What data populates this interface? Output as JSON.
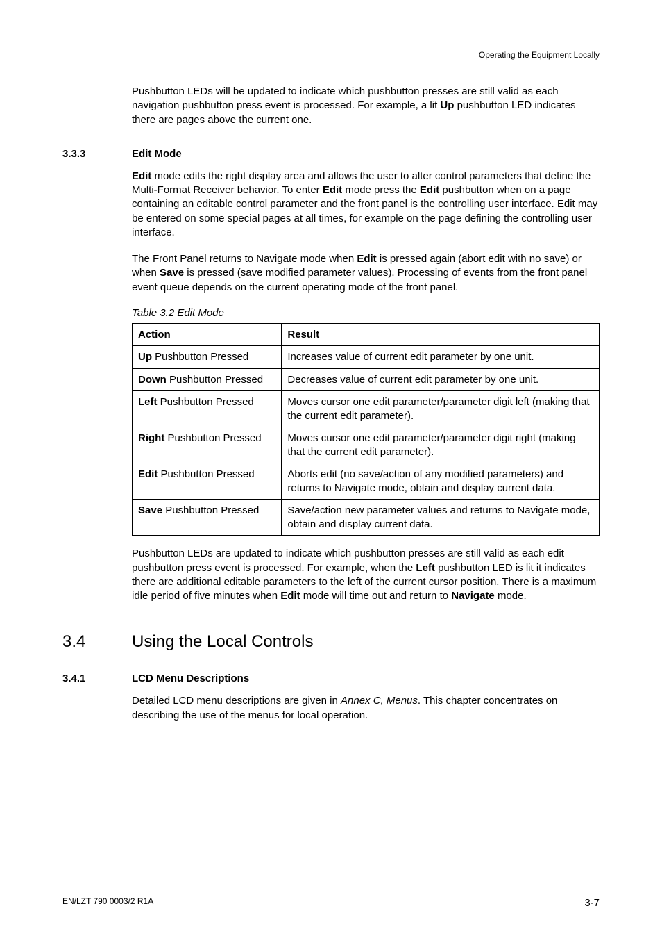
{
  "running_header": "Operating the Equipment Locally",
  "intro_para": "Pushbutton LEDs will be updated to indicate which pushbutton presses are still valid as each navigation pushbutton press event is processed. For example, a lit <b class=\"k\">Up</b> pushbutton LED indicates there are pages above the current one.",
  "s333": {
    "num": "3.3.3",
    "title": "Edit Mode",
    "p1": "<b class=\"k\">Edit</b> mode edits the right display area and allows the user to alter control parameters that define the Multi-Format Receiver behavior. To enter <b class=\"k\">Edit</b> mode press the <b class=\"k\">Edit</b> pushbutton when on a page containing an editable control parameter and the front panel is the controlling user interface. Edit may be entered on some special pages at all times, for example on the page defining the controlling user interface.",
    "p2": "The Front Panel returns to Navigate mode when <b class=\"k\">Edit</b> is pressed again (abort edit with no save) or when <b class=\"k\">Save</b> is pressed (save modified parameter values). Processing of events from the front panel event queue depends on the current operating mode of the front panel."
  },
  "table_caption": "Table 3.2   Edit Mode",
  "table": {
    "headers": {
      "action": "Action",
      "result": "Result"
    },
    "rows": [
      {
        "action": "<b class=\"k\">Up</b> Pushbutton Pressed",
        "result": "Increases value of current edit parameter by one unit."
      },
      {
        "action": "<b class=\"k\">Down</b> Pushbutton Pressed",
        "result": "Decreases value of current edit parameter by one unit."
      },
      {
        "action": "<b class=\"k\">Left</b> Pushbutton Pressed",
        "result": "Moves cursor one edit parameter/parameter digit left (making that the current edit parameter)."
      },
      {
        "action": "<b class=\"k\">Right</b> Pushbutton Pressed",
        "result": "Moves cursor one edit parameter/parameter digit right (making that the current edit parameter)."
      },
      {
        "action": "<b class=\"k\">Edit</b> Pushbutton Pressed",
        "result": "Aborts edit (no save/action of any modified parameters) and returns to Navigate mode, obtain and display current data."
      },
      {
        "action": "<b class=\"k\">Save</b> Pushbutton Pressed",
        "result": "Save/action new parameter values and returns to Navigate mode, obtain and display current data."
      }
    ]
  },
  "post_table_para": "Pushbutton LEDs are updated to indicate which pushbutton presses are still valid as each edit pushbutton press event is processed. For example, when the <b class=\"k\">Left</b> pushbutton LED is lit it indicates there are additional editable parameters to the left of the current cursor position. There is a maximum idle period of five minutes when <b class=\"k\">Edit</b> mode will time out and return to <b class=\"k\">Navigate</b> mode.",
  "s34": {
    "num": "3.4",
    "title": "Using the Local Controls"
  },
  "s341": {
    "num": "3.4.1",
    "title": "LCD Menu Descriptions",
    "p1": "Detailed LCD menu descriptions are given in <i>Annex C, Menus</i>. This chapter concentrates on describing the use of the menus for local operation."
  },
  "footer": {
    "left": "EN/LZT 790 0003/2 R1A",
    "right": "3-7"
  }
}
